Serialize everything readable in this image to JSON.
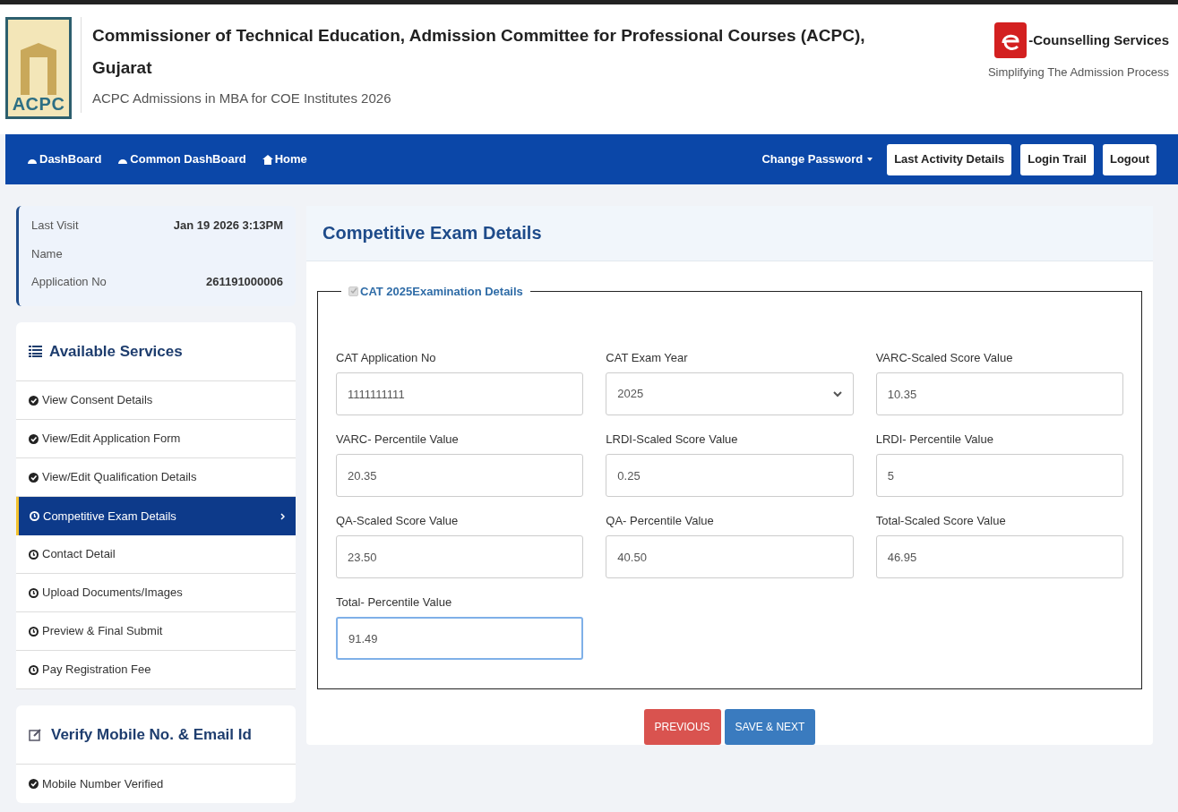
{
  "header": {
    "title_line1": "Commissioner of Technical Education, Admission Committee for Professional Courses (ACPC),",
    "title_line2": "Gujarat",
    "subtitle": "ACPC Admissions in MBA for COE Institutes 2026",
    "logo_text": "ACPC",
    "brand": "-Counselling Services",
    "tagline": "Simplifying The Admission Process"
  },
  "nav": {
    "links": [
      "DashBoard",
      "Common DashBoard",
      "Home"
    ],
    "dropdown": "Change Password",
    "buttons": [
      "Last Activity Details",
      "Login Trail",
      "Logout"
    ]
  },
  "info": [
    {
      "label": "Last Visit",
      "value": "Jan 19 2026 3:13PM"
    },
    {
      "label": "Name"
    },
    {
      "label": "Application No",
      "value": "261191000006"
    }
  ],
  "services": {
    "title": "Available Services",
    "items": [
      {
        "label": "View Consent Details",
        "kind": "done",
        "selected": false
      },
      {
        "label": "View/Edit Application Form",
        "kind": "done",
        "selected": false
      },
      {
        "label": "View/Edit Qualification Details",
        "kind": "done",
        "selected": false
      },
      {
        "label": "Competitive Exam Details",
        "kind": "pending",
        "selected": true
      },
      {
        "label": "Contact Detail",
        "kind": "pending",
        "selected": false
      },
      {
        "label": "Upload Documents/Images",
        "kind": "pending",
        "selected": false
      },
      {
        "label": "Preview & Final Submit",
        "kind": "pending",
        "selected": false
      },
      {
        "label": "Pay Registration Fee",
        "kind": "pending",
        "selected": false
      }
    ]
  },
  "verify": {
    "title": "Verify Mobile No. & Email Id",
    "items": [
      {
        "label": "Mobile Number Verified",
        "kind": "done"
      }
    ]
  },
  "panel": {
    "title": "Competitive Exam Details",
    "legend": "CAT 2025Examination Details",
    "legend_checked": true,
    "fields": [
      {
        "label": "CAT Application No",
        "value": "1111111111",
        "kind": "text",
        "focused": false
      },
      {
        "label": "CAT Exam Year",
        "value": "2025",
        "kind": "select",
        "focused": false
      },
      {
        "label": "VARC-Scaled Score Value",
        "value": "10.35",
        "kind": "text",
        "focused": false
      },
      {
        "label": "VARC- Percentile Value",
        "value": "20.35",
        "kind": "text",
        "focused": false
      },
      {
        "label": "LRDI-Scaled Score Value",
        "value": "0.25",
        "kind": "text",
        "focused": false
      },
      {
        "label": "LRDI- Percentile Value",
        "value": "5",
        "kind": "text",
        "focused": false
      },
      {
        "label": "QA-Scaled Score Value",
        "value": "23.50",
        "kind": "text",
        "focused": false
      },
      {
        "label": "QA- Percentile Value",
        "value": "40.50",
        "kind": "text",
        "focused": false
      },
      {
        "label": "Total-Scaled Score Value",
        "value": "46.95",
        "kind": "text",
        "focused": false
      },
      {
        "label": "Total- Percentile Value",
        "value": "91.49",
        "kind": "text",
        "focused": true
      }
    ],
    "buttons": [
      {
        "label": "PREVIOUS",
        "kind": "danger"
      },
      {
        "label": "SAVE & NEXT",
        "kind": "primary"
      }
    ]
  }
}
